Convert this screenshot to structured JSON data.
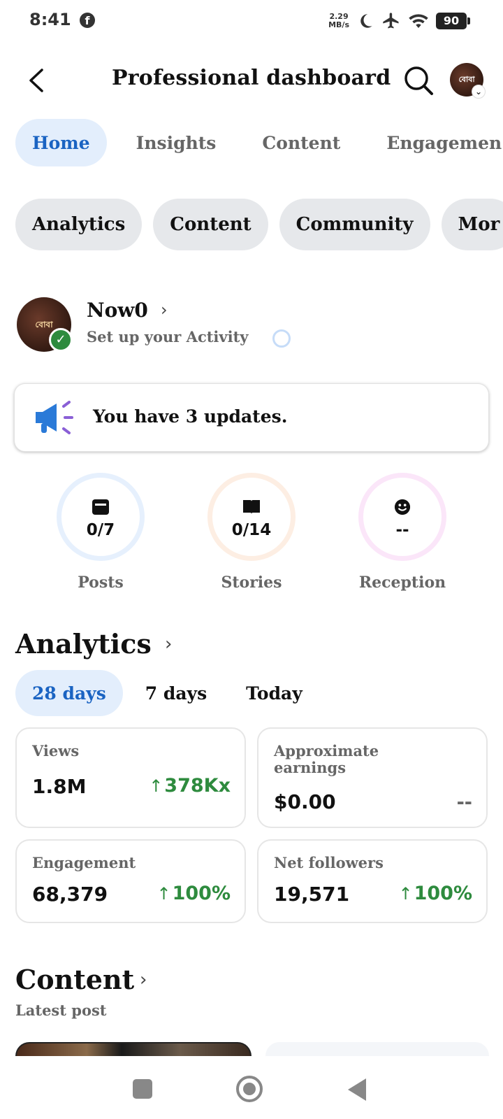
{
  "status_bar": {
    "time": "8:41",
    "net_speed_value": "2.29",
    "net_speed_unit": "MB/s",
    "battery": "90"
  },
  "header": {
    "title": "Professional dashboard",
    "avatar_text": "বোবা"
  },
  "tabs": [
    {
      "label": "Home",
      "active": true
    },
    {
      "label": "Insights",
      "active": false
    },
    {
      "label": "Content",
      "active": false
    },
    {
      "label": "Engagemen",
      "active": false
    }
  ],
  "chips": [
    "Analytics",
    "Content",
    "Community",
    "Mor"
  ],
  "profile": {
    "name": "Now0",
    "subtitle": "Set up your Activity",
    "avatar_text": "বোবা"
  },
  "updates": {
    "text": "You have 3 updates."
  },
  "stats": [
    {
      "label": "Posts",
      "value": "0/7",
      "icon": "posts-icon",
      "ring_color": "#e6f0fd"
    },
    {
      "label": "Stories",
      "value": "0/14",
      "icon": "book-icon",
      "ring_color": "#fdeee3"
    },
    {
      "label": "Reception",
      "value": "--",
      "icon": "smiley-icon",
      "ring_color": "#fbe6f9"
    }
  ],
  "analytics": {
    "title": "Analytics",
    "ranges": [
      {
        "label": "28 days",
        "active": true
      },
      {
        "label": "7 days",
        "active": false
      },
      {
        "label": "Today",
        "active": false
      }
    ],
    "metrics": [
      {
        "label": "Views",
        "value": "1.8M",
        "change": "378Kx",
        "trend": "up"
      },
      {
        "label": "Approximate earnings",
        "value": "$0.00",
        "change": "--",
        "trend": "none"
      },
      {
        "label": "Engagement",
        "value": "68,379",
        "change": "100%",
        "trend": "up"
      },
      {
        "label": "Net followers",
        "value": "19,571",
        "change": "100%",
        "trend": "up"
      }
    ]
  },
  "content": {
    "title": "Content",
    "subtitle": "Latest post"
  },
  "colors": {
    "accent": "#1a63c2",
    "accent_bg": "#e3eefc",
    "positive": "#2e8b3e",
    "chip_bg": "#e6e8eb"
  }
}
